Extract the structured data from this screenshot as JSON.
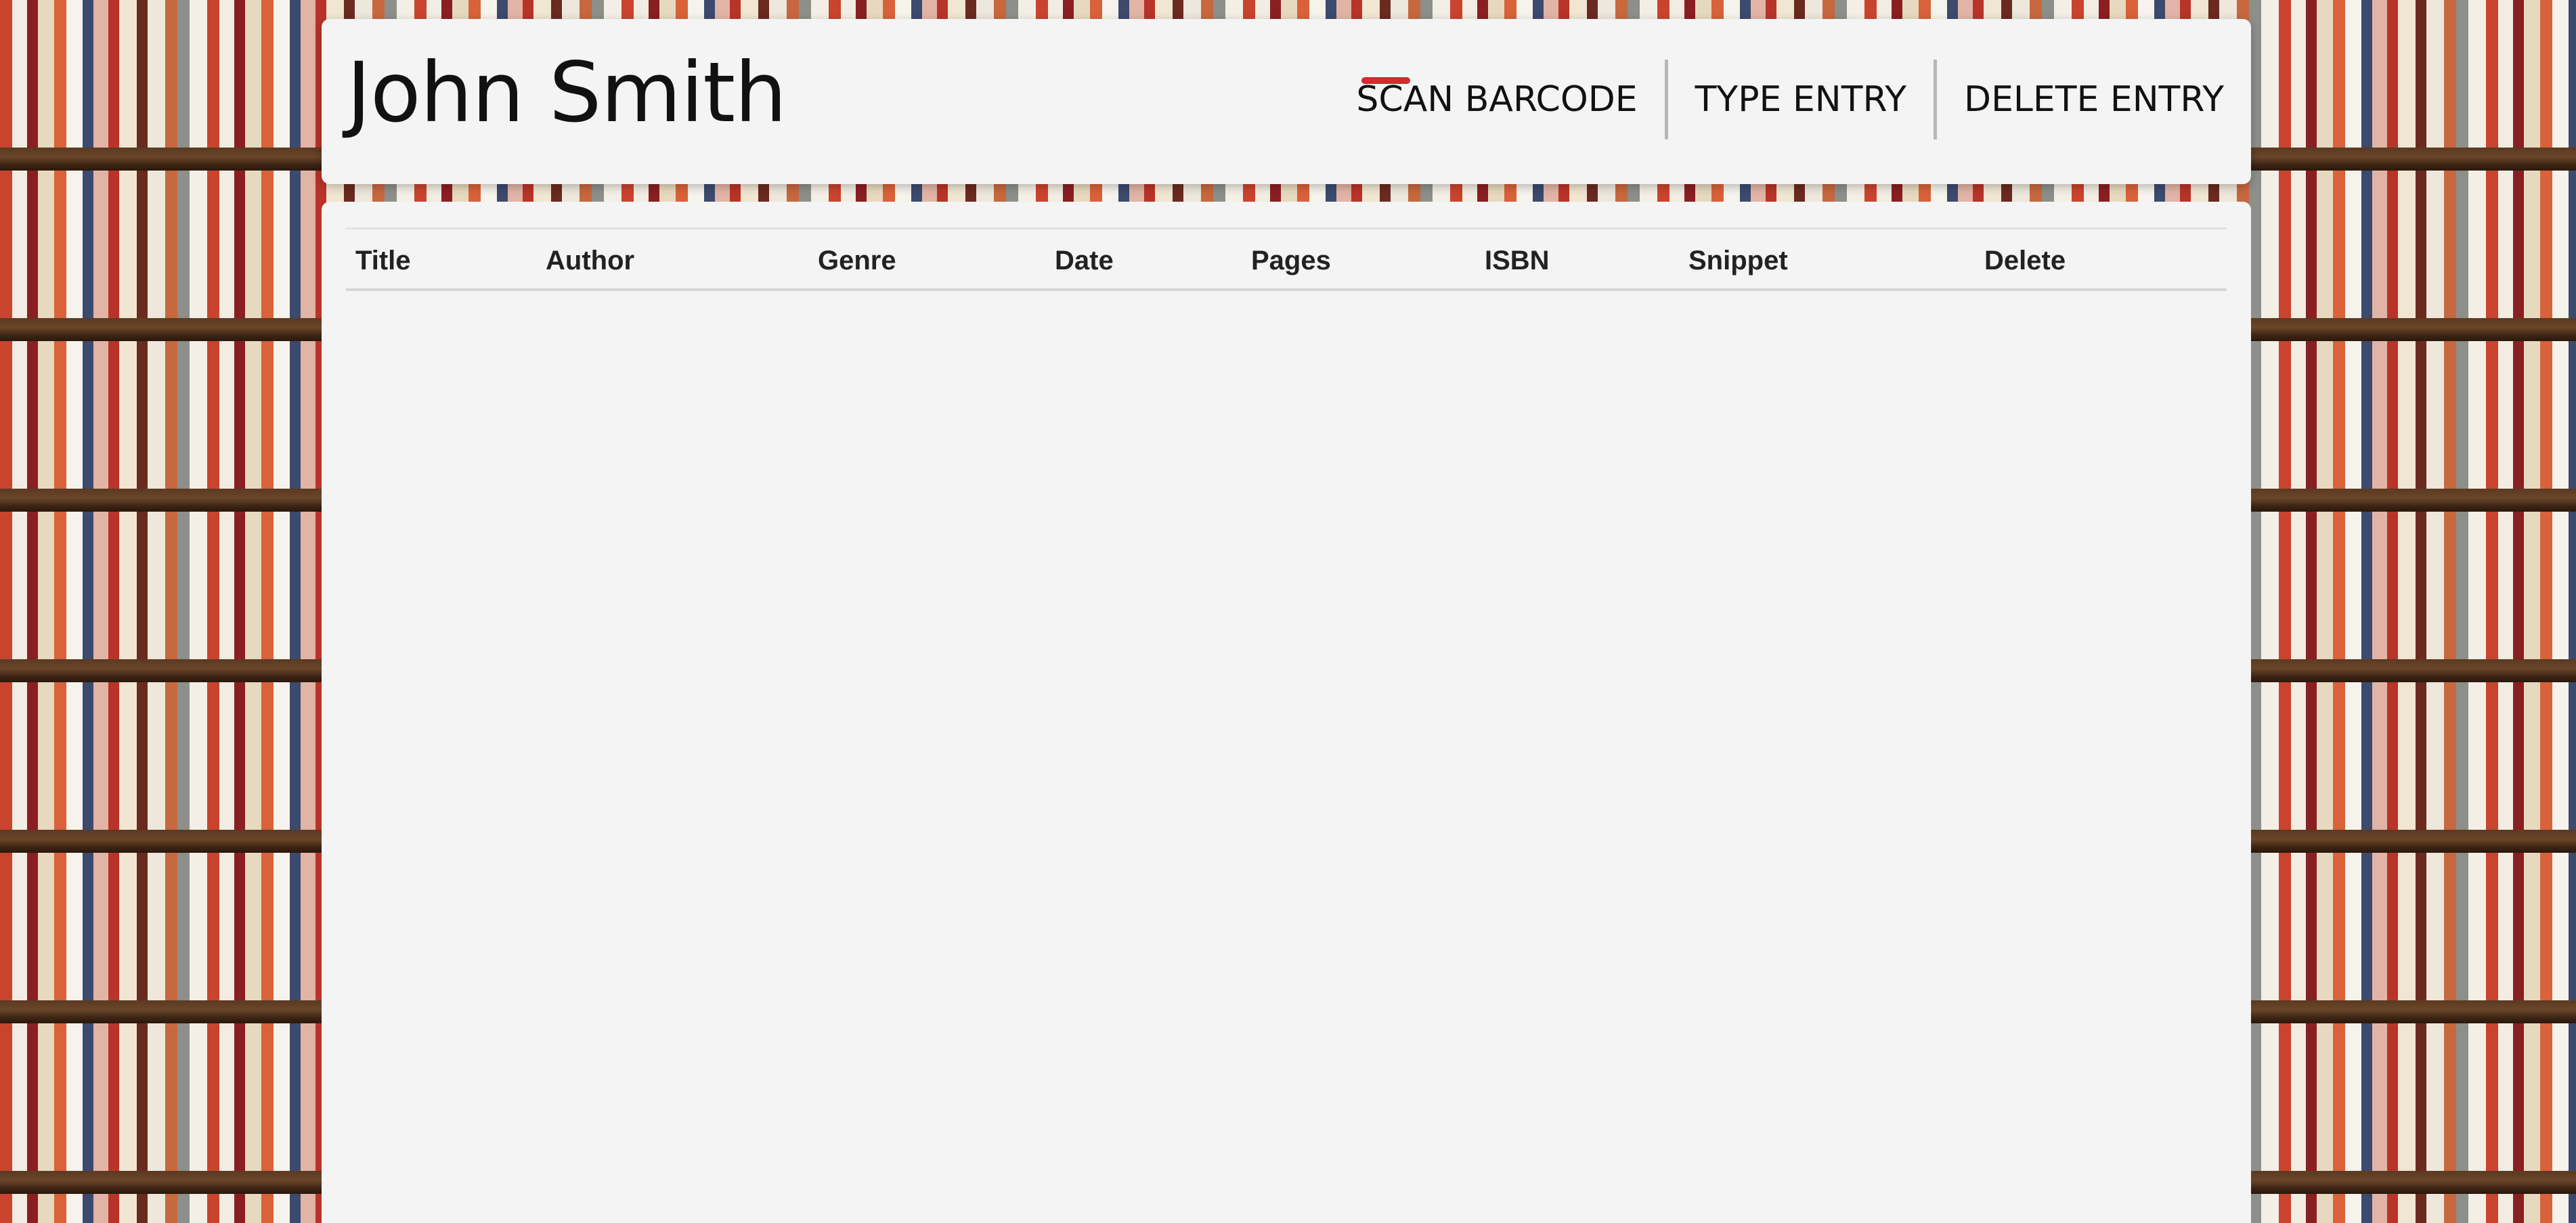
{
  "header": {
    "user_name": "John Smith",
    "nav": [
      {
        "label": "SCAN BARCODE",
        "active": true
      },
      {
        "label": "TYPE ENTRY",
        "active": false
      },
      {
        "label": "DELETE ENTRY",
        "active": false
      }
    ],
    "active_indicator_color": "#d42b2b"
  },
  "table": {
    "columns": [
      "Title",
      "Author",
      "Genre",
      "Date",
      "Pages",
      "ISBN",
      "Snippet",
      "Delete"
    ],
    "rows": []
  }
}
